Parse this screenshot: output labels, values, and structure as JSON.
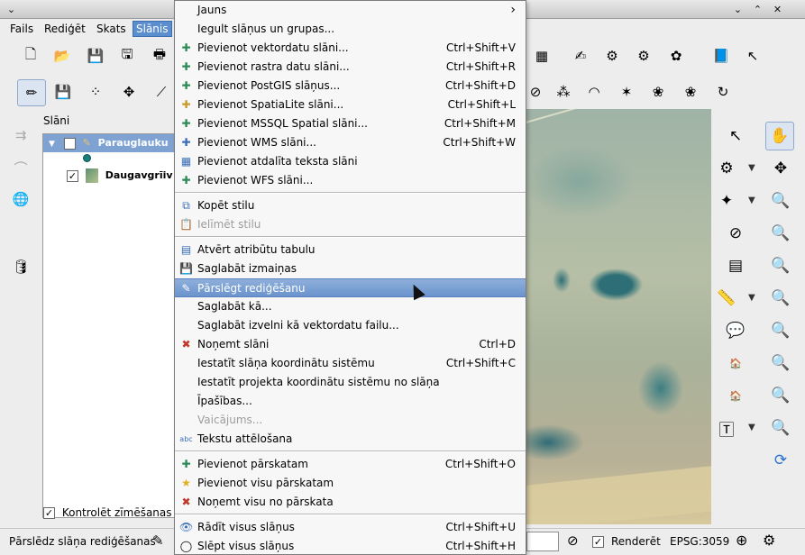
{
  "window": {
    "minimize_label": "⌄",
    "close_label": "✕",
    "restore_label": "⌃"
  },
  "menubar": {
    "items": [
      {
        "label": "Fails"
      },
      {
        "label": "Rediģēt"
      },
      {
        "label": "Skats"
      },
      {
        "label": "Slānis"
      }
    ]
  },
  "layers_panel": {
    "title": "Slāni",
    "layers": [
      {
        "name": "Parauglauku",
        "checked": true
      },
      {
        "name": "Daugavgrīiv",
        "checked": true
      }
    ],
    "render_check_label": "Kontrolēt zīmēšanas"
  },
  "layer_menu": {
    "items": [
      {
        "label": "Jauns",
        "shortcut": "",
        "icon": "",
        "submenu_arrow": "›"
      },
      {
        "label": "Iegult slāņus un grupas...",
        "shortcut": "",
        "icon": ""
      },
      {
        "label": "Pievienot vektordatu slāni...",
        "shortcut": "Ctrl+Shift+V",
        "icon": "✚"
      },
      {
        "label": "Pievienot rastra datu slāni...",
        "shortcut": "Ctrl+Shift+R",
        "icon": "✚"
      },
      {
        "label": "Pievienot PostGIS slāņus...",
        "shortcut": "Ctrl+Shift+D",
        "icon": "✚"
      },
      {
        "label": "Pievienot SpatiaLite slāni...",
        "shortcut": "Ctrl+Shift+L",
        "icon": "✚"
      },
      {
        "label": "Pievienot MSSQL Spatial slāni...",
        "shortcut": "Ctrl+Shift+M",
        "icon": "✚"
      },
      {
        "label": "Pievienot WMS slāni...",
        "shortcut": "Ctrl+Shift+W",
        "icon": "✚"
      },
      {
        "label": "Pievienot atdalīta teksta slāni",
        "shortcut": "",
        "icon": "▦"
      },
      {
        "label": "Pievienot WFS slāni...",
        "shortcut": "",
        "icon": "✚"
      },
      {
        "label": "Kopēt stilu",
        "shortcut": "",
        "icon": "⧉"
      },
      {
        "label": "Ielīmēt stilu",
        "shortcut": "",
        "icon": "📋"
      },
      {
        "label": "Atvērt atribūtu tabulu",
        "shortcut": "",
        "icon": "▤"
      },
      {
        "label": "Saglabāt izmaiņas",
        "shortcut": "",
        "icon": "💾"
      },
      {
        "label": "Pārslēgt rediģēšanu",
        "shortcut": "",
        "icon": "✎"
      },
      {
        "label": "Saglabāt kā...",
        "shortcut": "",
        "icon": ""
      },
      {
        "label": "Saglabāt izvelni kā vektordatu failu...",
        "shortcut": "",
        "icon": ""
      },
      {
        "label": "Noņemt slāni",
        "shortcut": "Ctrl+D",
        "icon": "✖"
      },
      {
        "label": "Iestatīt slāņa koordinātu sistēmu",
        "shortcut": "Ctrl+Shift+C",
        "icon": ""
      },
      {
        "label": "Iestatīt projekta koordinātu sistēmu no slāņa",
        "shortcut": "",
        "icon": ""
      },
      {
        "label": "Īpašības...",
        "shortcut": "",
        "icon": ""
      },
      {
        "label": "Vaicājums...",
        "shortcut": "",
        "icon": ""
      },
      {
        "label": "Tekstu attēlošana",
        "shortcut": "",
        "icon": "abc"
      },
      {
        "label": "Pievienot pārskatam",
        "shortcut": "Ctrl+Shift+O",
        "icon": "✚"
      },
      {
        "label": "Pievienot visu pārskatam",
        "shortcut": "",
        "icon": "★"
      },
      {
        "label": "Noņemt visu no pārskata",
        "shortcut": "",
        "icon": "✖"
      },
      {
        "label": "Rādīt visus slāņus",
        "shortcut": "Ctrl+Shift+U",
        "icon": "👁"
      },
      {
        "label": "Slēpt visus slāņus",
        "shortcut": "Ctrl+Shift+H",
        "icon": "◯"
      }
    ]
  },
  "statusbar": {
    "message": "Pārslēdz slāņa rediģēšanas",
    "render_label": "Renderēt",
    "crs_label": "EPSG:3059"
  },
  "colors": {
    "menu_highlight": "#6b93cc",
    "menubar_active": "#5b8ecf"
  }
}
